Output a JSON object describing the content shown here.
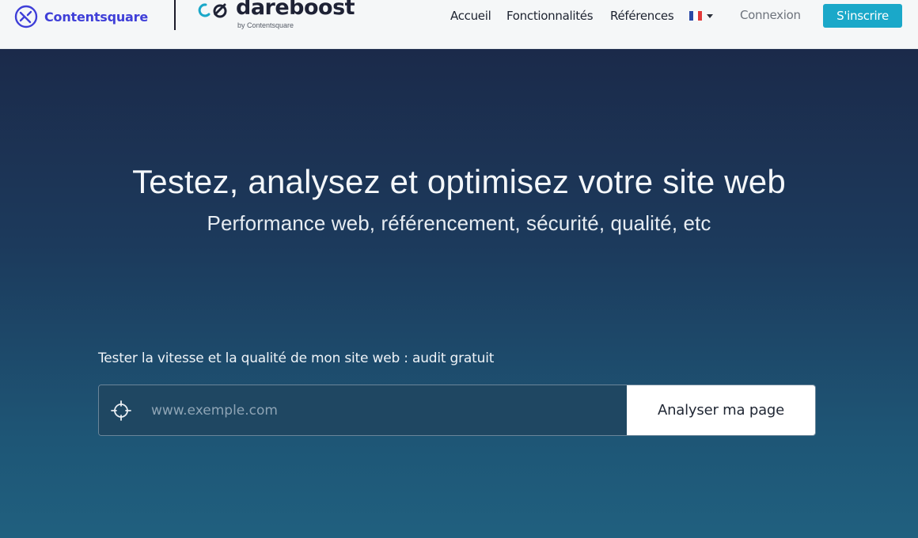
{
  "header": {
    "contentsquare_logo_text": "Contentsquare",
    "dareboost_logo_text": "dareboost",
    "dareboost_logo_sub": "by Contentsquare",
    "nav": [
      {
        "label": "Accueil"
      },
      {
        "label": "Fonctionnalités"
      },
      {
        "label": "Références"
      }
    ],
    "language_flag_icon": "flag-fr-icon",
    "login_label": "Connexion",
    "signup_label": "S'inscrire"
  },
  "hero": {
    "title": "Testez, analysez et optimisez votre site web",
    "subtitle": "Performance web, référencement, sécurité, qualité, etc",
    "audit_label": "Tester la vitesse et la qualité de mon site web : audit gratuit",
    "url_placeholder": "www.exemple.com",
    "url_value": "",
    "analyse_button_label": "Analyser ma page",
    "target_icon": "crosshair-icon"
  },
  "colors": {
    "contentsquare_brand": "#3f3fd8",
    "signup_button": "#1aa8c9",
    "hero_top": "#1b2a4a",
    "hero_bottom": "#20607f"
  }
}
